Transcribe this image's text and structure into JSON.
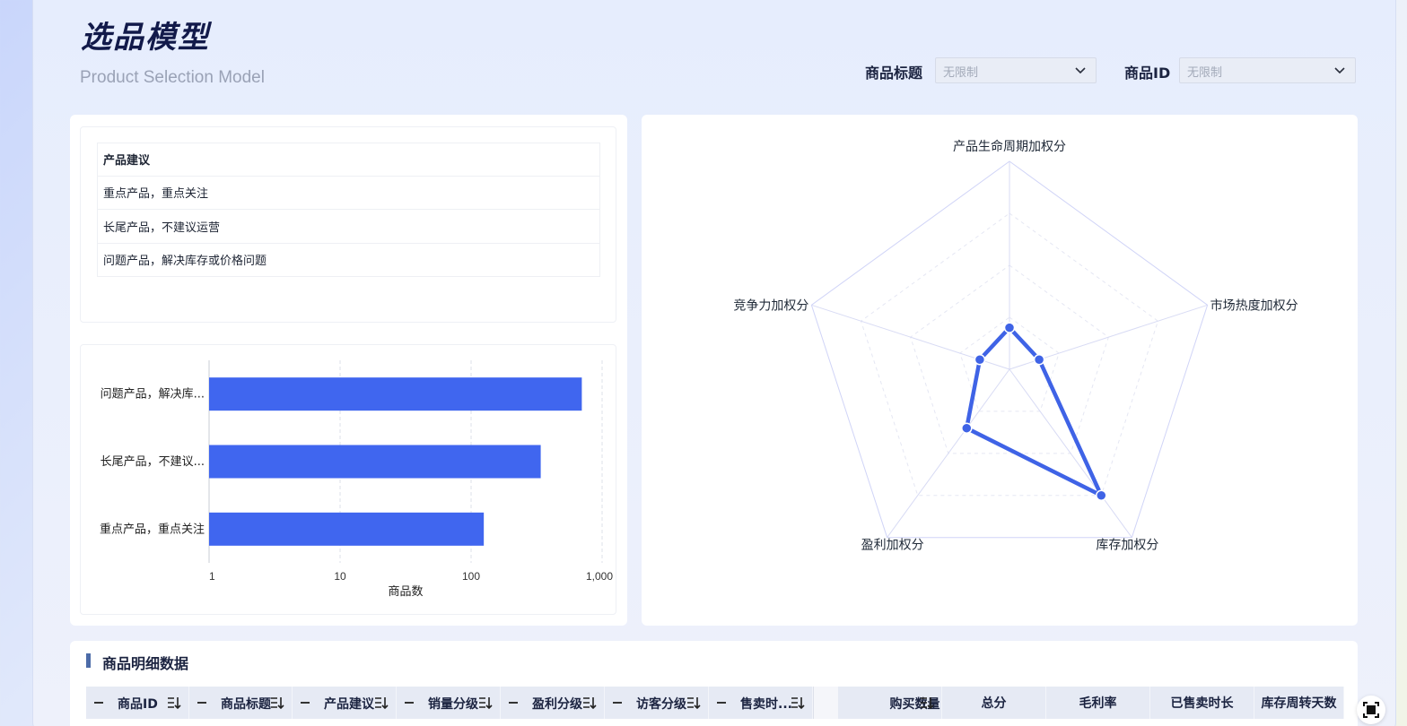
{
  "header": {
    "title": "选品模型",
    "subtitle": "Product Selection Model",
    "filters": [
      {
        "label": "商品标题",
        "value": "无限制"
      },
      {
        "label": "商品ID",
        "value": "无限制"
      }
    ]
  },
  "suggestions": {
    "header": "产品建议",
    "rows": [
      "重点产品，重点关注",
      "长尾产品，不建议运营",
      "问题产品，解决库存或价格问题"
    ]
  },
  "chart_data": [
    {
      "type": "bar",
      "orientation": "horizontal",
      "categories": [
        "问题产品，解决库...",
        "长尾产品，不建议...",
        "重点产品，重点关注"
      ],
      "values": [
        700,
        340,
        125
      ],
      "xlabel": "商品数",
      "xscale": "log",
      "xlim": [
        1,
        1000
      ],
      "xticks": [
        "1",
        "10",
        "100",
        "1,000"
      ],
      "color": "#4066ef"
    },
    {
      "type": "radar",
      "axes": [
        "产品生命周期加权分",
        "市场热度加权分",
        "库存加权分",
        "盈利加权分",
        "竞争力加权分"
      ],
      "values": [
        0.2,
        0.15,
        0.75,
        0.35,
        0.15
      ],
      "color": "#3f63e6"
    }
  ],
  "detail": {
    "title": "商品明细数据",
    "columns": [
      {
        "label": "商品ID",
        "expandable": true,
        "sortable": true
      },
      {
        "label": "商品标题",
        "expandable": true,
        "sortable": true
      },
      {
        "label": "产品建议",
        "expandable": true,
        "sortable": true
      },
      {
        "label": "销量分级",
        "expandable": true,
        "sortable": true
      },
      {
        "label": "盈利分级",
        "expandable": true,
        "sortable": true
      },
      {
        "label": "访客分级",
        "expandable": true,
        "sortable": true
      },
      {
        "label": "售卖时...",
        "expandable": true,
        "sortable": true
      },
      {
        "label": "购买数量",
        "expandable": false,
        "sortable": true
      },
      {
        "label": "总分",
        "expandable": false,
        "sortable": false
      },
      {
        "label": "毛利率",
        "expandable": false,
        "sortable": false
      },
      {
        "label": "已售卖时长",
        "expandable": false,
        "sortable": false
      },
      {
        "label": "库存周转天数",
        "expandable": false,
        "sortable": false
      }
    ]
  },
  "icons": {
    "chevron": "chevron-down-icon",
    "sort": "sort-icon",
    "fullscreen": "fullscreen-icon"
  }
}
